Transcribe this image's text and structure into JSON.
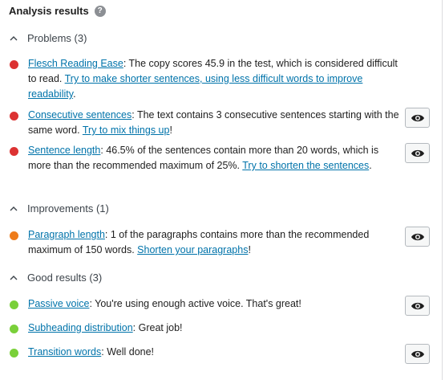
{
  "header": {
    "title": "Analysis results",
    "help_icon": "help-circle-icon"
  },
  "colors": {
    "problem": "#dc3232",
    "improvement": "#ee7c1b",
    "good": "#7ad03a",
    "link": "#0073aa"
  },
  "sections": {
    "problems": {
      "label": "Problems (3)",
      "items": [
        {
          "link": "Flesch Reading Ease",
          "text": ": The copy scores 45.9 in the test, which is considered difficult to read. ",
          "action": "Try to make shorter sentences, using less difficult words to improve readability",
          "tail": "."
        },
        {
          "link": "Consecutive sentences",
          "text": ": The text contains 3 consecutive sentences starting with the same word. ",
          "action": "Try to mix things up",
          "tail": "!"
        },
        {
          "link": "Sentence length",
          "text": ": 46.5% of the sentences contain more than 20 words, which is more than the recommended maximum of 25%. ",
          "action": "Try to shorten the sentences",
          "tail": "."
        }
      ]
    },
    "improvements": {
      "label": "Improvements (1)",
      "items": [
        {
          "link": "Paragraph length",
          "text": ": 1 of the paragraphs contains more than the recommended maximum of 150 words. ",
          "action": "Shorten your paragraphs",
          "tail": "!"
        }
      ]
    },
    "good": {
      "label": "Good results (3)",
      "items": [
        {
          "link": "Passive voice",
          "text": ": You're using enough active voice. That's great!"
        },
        {
          "link": "Subheading distribution",
          "text": ": Great job!"
        },
        {
          "link": "Transition words",
          "text": ": Well done!"
        }
      ]
    }
  }
}
